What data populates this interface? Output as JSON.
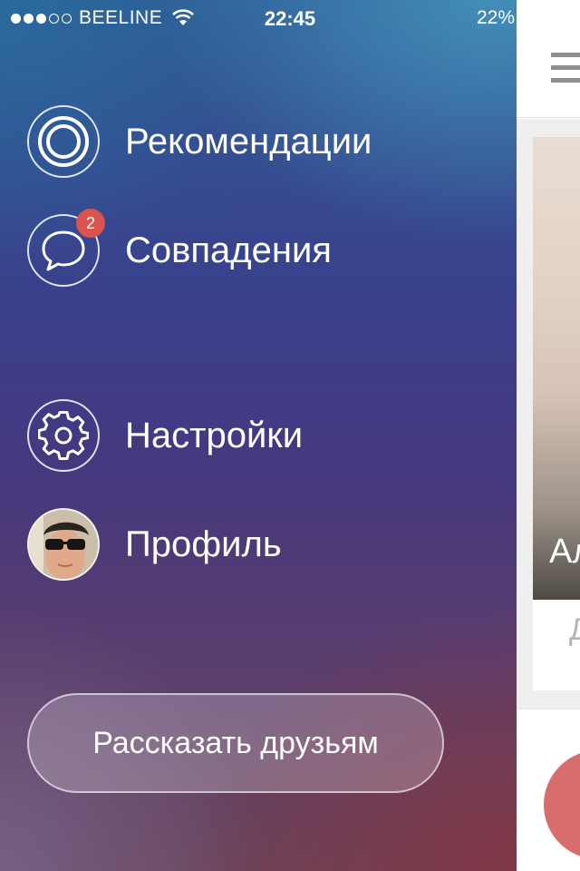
{
  "status_bar": {
    "carrier": "BEELINE",
    "time": "22:45",
    "battery": "22%",
    "signal_strength": 3,
    "signal_max": 5,
    "wifi_icon": "wifi-icon"
  },
  "menu": {
    "items": [
      {
        "label": "Рекомендации",
        "icon": "target-icon"
      },
      {
        "label": "Совпадения",
        "icon": "chat-bubble-icon",
        "badge": "2"
      },
      {
        "label": "Настройки",
        "icon": "gear-icon"
      },
      {
        "label": "Профиль",
        "icon": "avatar"
      }
    ],
    "share_button": "Рассказать друзьям"
  },
  "main_screen": {
    "nav_icon": "hamburger-icon",
    "card_name_partial": "Ал",
    "card_sub_partial": "Д"
  },
  "colors": {
    "badge": "#d9534f",
    "dislike": "#d86d6d"
  }
}
